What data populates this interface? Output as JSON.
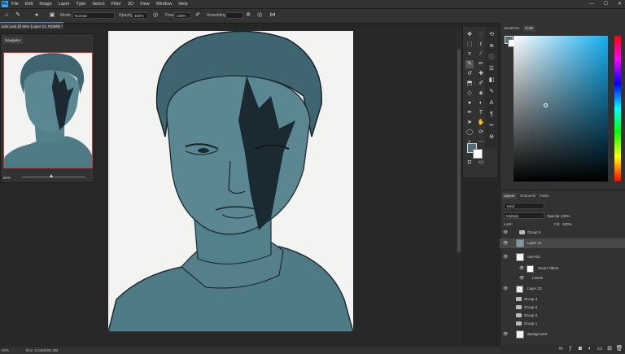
{
  "menu": {
    "logo": "Ps",
    "items": [
      "File",
      "Edit",
      "Image",
      "Layer",
      "Type",
      "Select",
      "Filter",
      "3D",
      "View",
      "Window",
      "Help"
    ],
    "win_controls": [
      "—",
      "☐",
      "✕"
    ]
  },
  "options_bar": {
    "mode_label": "Mode:",
    "mode_value": "Normal",
    "opacity_label": "Opacity:",
    "opacity_value": "100%",
    "flow_label": "Flow:",
    "flow_value": "100%",
    "smoothing_label": "Smoothing:",
    "smoothing_value": ""
  },
  "document": {
    "tab_title": "amin.psd @ 50% (Layer 21, RGB/8) *"
  },
  "navigator": {
    "tab_label": "Navigator",
    "zoom_value": "50%"
  },
  "status_bar": {
    "zoom": "50%",
    "doc_info": "Doc: 6.24M/201.0M"
  },
  "color_panel": {
    "tabs": [
      "Swatches",
      "Color"
    ],
    "active_tab": "Color",
    "foreground_color": "#4b6e78",
    "background_color": "#ffffff"
  },
  "layers_panel": {
    "tabs": [
      "Layers",
      "Channels",
      "Paths"
    ],
    "filter_label": "Kind",
    "blend_mode": "Multiply",
    "opacity_label": "Opacity:",
    "opacity_value": "100%",
    "lock_label": "Lock:",
    "fill_label": "Fill:",
    "fill_value": "100%",
    "layers": [
      {
        "name": "Group 5",
        "type": "group"
      },
      {
        "name": "Layer 21",
        "type": "layer"
      },
      {
        "name": "скетч01",
        "type": "smart"
      },
      {
        "name": "Smart Filters",
        "type": "filter"
      },
      {
        "name": "Levels",
        "type": "filter-item"
      },
      {
        "name": "Layer 20",
        "type": "layer"
      },
      {
        "name": "Group 4",
        "type": "group"
      },
      {
        "name": "Group 3",
        "type": "group"
      },
      {
        "name": "Group 2",
        "type": "group"
      },
      {
        "name": "Group 1",
        "type": "group"
      },
      {
        "name": "Background",
        "type": "background"
      }
    ]
  },
  "colors": {
    "accent": "#31a8ff",
    "paint": "#4b6e78"
  }
}
